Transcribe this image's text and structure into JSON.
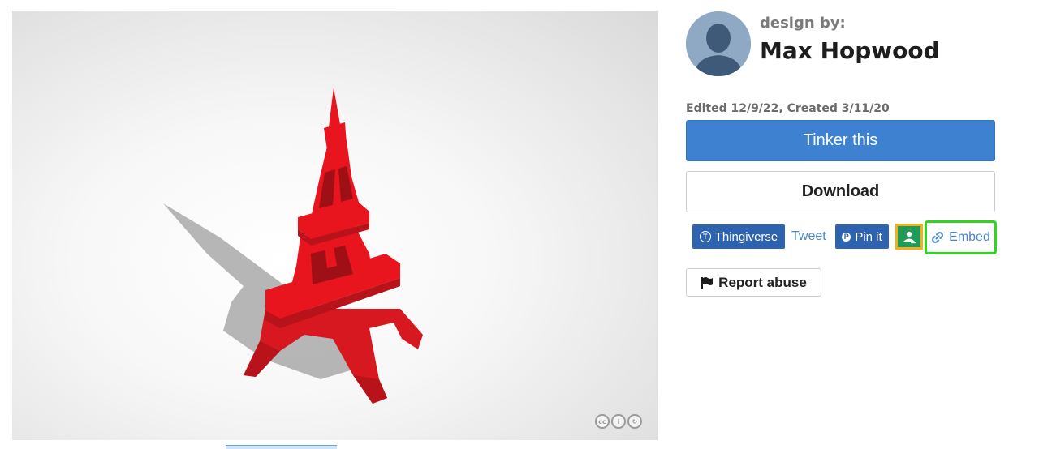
{
  "viewer": {
    "license_badges": [
      {
        "icon": "cc-icon",
        "glyph": "cc"
      },
      {
        "icon": "by-icon",
        "glyph": "i"
      },
      {
        "icon": "sa-icon",
        "glyph": "↻"
      }
    ],
    "model_color": "#e8141e"
  },
  "designer": {
    "label": "design by:",
    "name": "Max Hopwood",
    "avatar_icon": "user-silhouette-icon"
  },
  "meta": {
    "edited_created": "Edited 12/9/22, Created 3/11/20"
  },
  "actions": {
    "tinker_label": "Tinker this",
    "download_label": "Download",
    "report_label": "Report abuse",
    "report_icon": "flag-icon"
  },
  "share": {
    "thingiverse_label": "Thingiverse",
    "tweet_label": "Tweet",
    "pin_label": "Pin it",
    "classroom_icon": "google-classroom-icon",
    "embed_label": "Embed",
    "embed_icon": "link-icon"
  },
  "colors": {
    "primary": "#3f81d1",
    "share_blue": "#2e63b0",
    "link": "#4b86c5",
    "highlight_green": "#2fd61e",
    "highlight_orange": "#f2b01e"
  }
}
